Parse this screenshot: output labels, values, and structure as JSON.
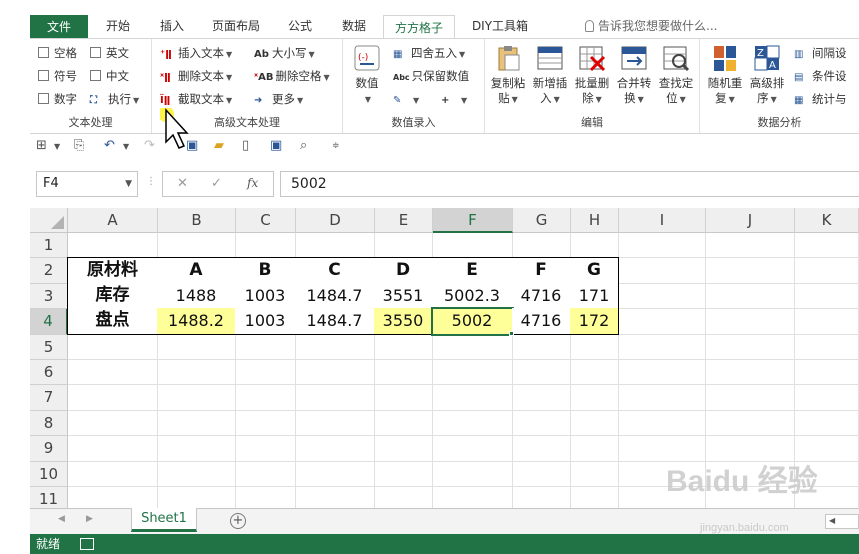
{
  "tabs": [
    "文件",
    "开始",
    "插入",
    "页面布局",
    "公式",
    "数据",
    "方方格子",
    "DIY工具箱"
  ],
  "active_tab": "方方格子",
  "tell_me": "告诉我您想要做什么...",
  "ribbon": {
    "text_group": {
      "label": "文本处理",
      "items": [
        "空格",
        "英文",
        "符号",
        "中文",
        "数字",
        "执行"
      ]
    },
    "adv_text_group": {
      "label": "高级文本处理",
      "items": [
        "插入文本",
        "大小写",
        "删除文本",
        "删除空格",
        "截取文本",
        "更多"
      ]
    },
    "value_group": {
      "label": "数值录入",
      "big": "数值",
      "items": [
        "四舍五入",
        "只保留数值"
      ]
    },
    "edit_group": {
      "label": "编辑",
      "buttons": [
        {
          "l1": "复制粘",
          "l2": "贴"
        },
        {
          "l1": "新增插",
          "l2": "入"
        },
        {
          "l1": "批量删",
          "l2": "除"
        },
        {
          "l1": "合并转",
          "l2": "换"
        },
        {
          "l1": "查找定",
          "l2": "位"
        }
      ]
    },
    "analysis_group": {
      "label": "数据分析",
      "buttons": [
        {
          "l1": "随机重",
          "l2": "复"
        },
        {
          "l1": "高级排",
          "l2": "序"
        }
      ],
      "items": [
        "间隔设",
        "条件设",
        "统计与"
      ]
    }
  },
  "formula_bar": {
    "name_box": "F4",
    "fx": "fx",
    "value": "5002"
  },
  "columns": [
    "A",
    "B",
    "C",
    "D",
    "E",
    "F",
    "G",
    "H",
    "I",
    "J",
    "K"
  ],
  "rows": [
    "1",
    "2",
    "3",
    "4",
    "5",
    "6",
    "7",
    "8",
    "9",
    "10",
    "11"
  ],
  "table": {
    "header": [
      "原材料",
      "A",
      "B",
      "C",
      "D",
      "E",
      "F",
      "G"
    ],
    "stock": [
      "库存",
      "1488",
      "1003",
      "1484.7",
      "3551",
      "5002.3",
      "4716",
      "171"
    ],
    "count": [
      "盘点",
      "1488.2",
      "1003",
      "1484.7",
      "3550",
      "5002",
      "4716",
      "172"
    ]
  },
  "highlight_color": "#ffff99",
  "sheet_tab": "Sheet1",
  "status": "就绪",
  "watermark": "Baidu 经验",
  "watermark_sub": "jingyan.baidu.com",
  "accent_color": "#217346"
}
